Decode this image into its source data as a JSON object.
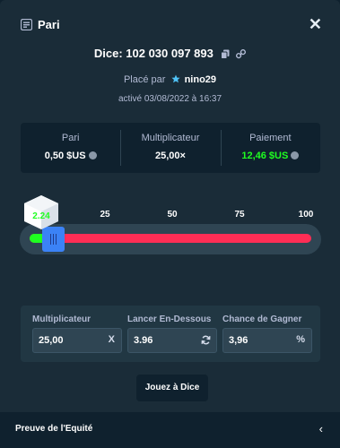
{
  "header": {
    "title": "Pari",
    "icon": "bet-slip-icon"
  },
  "bet": {
    "title": "Dice: 102 030 097 893",
    "placed_prefix": "Placé par",
    "username": "nino29",
    "activated": "activé 03/08/2022 à 16:37"
  },
  "stats": {
    "bet_label": "Pari",
    "bet_value": "0,50 $US",
    "multiplier_label": "Multiplicateur",
    "multiplier_value": "25,00×",
    "payout_label": "Paiement",
    "payout_value": "12,46 $US"
  },
  "slider": {
    "ticks": [
      "0",
      "25",
      "50",
      "75",
      "100"
    ],
    "result": "2.24",
    "roll_under": 3.96
  },
  "inputs": {
    "multiplier_label": "Multiplicateur",
    "multiplier_value": "25,00",
    "multiplier_suffix": "X",
    "roll_label": "Lancer En-Dessous",
    "roll_value": "3.96",
    "chance_label": "Chance de Gagner",
    "chance_value": "3,96",
    "chance_suffix": "%"
  },
  "play_button": "Jouez à Dice",
  "footer": {
    "label": "Preuve de l'Equité"
  },
  "colors": {
    "win": "#1fff20",
    "loss_track": "#ff2d55",
    "thumb": "#3b82f6"
  }
}
